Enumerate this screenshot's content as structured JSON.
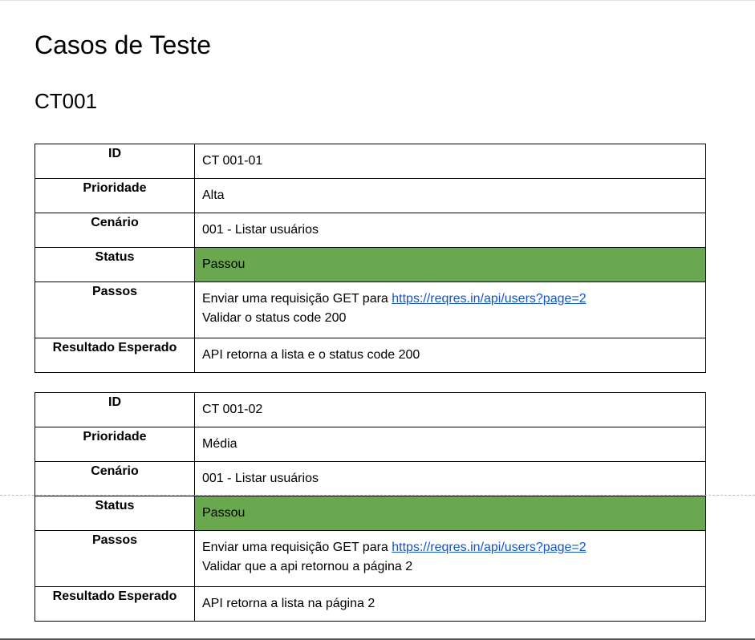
{
  "document": {
    "title": "Casos de Teste",
    "subtitle": "CT001"
  },
  "cases": [
    {
      "id_label": "ID",
      "id": "CT 001-01",
      "priority_label": "Prioridade",
      "priority": "Alta",
      "scenario_label": "Cenário",
      "scenario": "001 - Listar usuários",
      "status_label": "Status",
      "status": "Passou",
      "steps_label": "Passos",
      "steps_prefix": "Enviar uma requisição GET para ",
      "steps_link": "https://reqres.in/api/users?page=2",
      "steps_line2": "Validar o status code 200",
      "expected_label": "Resultado Esperado",
      "expected": "API retorna a lista e o status code 200"
    },
    {
      "id_label": "ID",
      "id": "CT 001-02",
      "priority_label": "Prioridade",
      "priority": "Média",
      "scenario_label": "Cenário",
      "scenario": "001 - Listar usuários",
      "status_label": "Status",
      "status": "Passou",
      "steps_label": "Passos",
      "steps_prefix": "Enviar uma requisição GET para ",
      "steps_link": "https://reqres.in/api/users?page=2",
      "steps_line2": "Validar que a api retornou a página 2",
      "expected_label": "Resultado Esperado",
      "expected": "API retorna a lista na página 2"
    }
  ],
  "colors": {
    "status_pass": "#6aa84f",
    "link": "#1155cc"
  }
}
